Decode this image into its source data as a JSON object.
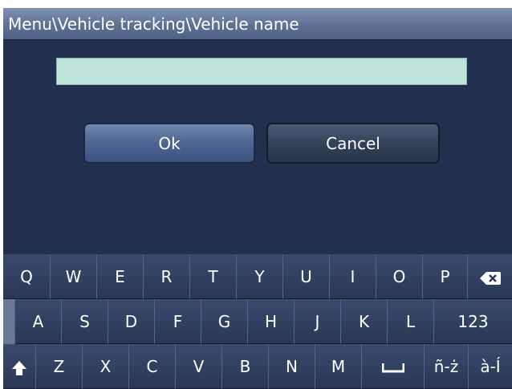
{
  "title": "Menu\\Vehicle tracking\\Vehicle name",
  "input": {
    "value": ""
  },
  "buttons": {
    "ok": "Ok",
    "cancel": "Cancel"
  },
  "keyboard": {
    "row1": [
      "Q",
      "W",
      "E",
      "R",
      "T",
      "Y",
      "U",
      "I",
      "O",
      "P"
    ],
    "row2": [
      "A",
      "S",
      "D",
      "F",
      "G",
      "H",
      "J",
      "K",
      "L",
      "123"
    ],
    "row3": [
      "Z",
      "X",
      "C",
      "V",
      "B",
      "N",
      "M"
    ],
    "accent_key": "ñ-ż",
    "special_key": "à-Í",
    "icons": {
      "backspace": "backspace-icon",
      "shift": "shift-icon",
      "space": "space-icon"
    }
  }
}
